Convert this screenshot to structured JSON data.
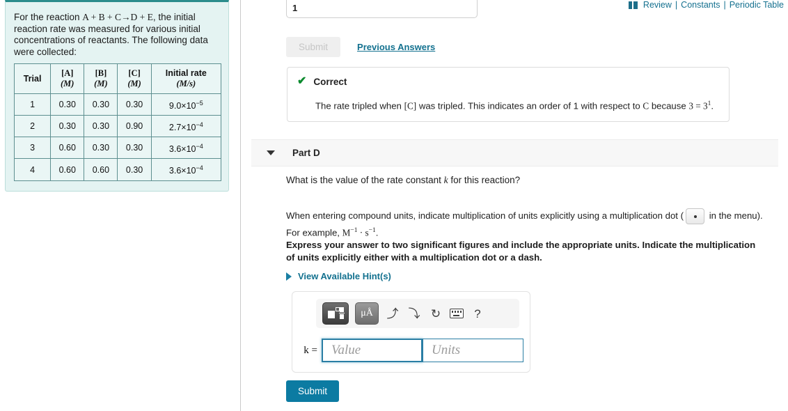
{
  "top_nav": {
    "icon": "review-book-icon",
    "items": [
      "Review",
      "Constants",
      "Periodic Table"
    ],
    "separator": "|",
    "link_color": "#14708f"
  },
  "problem_panel": {
    "intro_html": "For the reaction A + B + C→D + E, the initial reaction rate was measured for various initial concentrations of reactants. The following data were collected:",
    "intro_prefix": "For the reaction ",
    "reaction": "A + B + C→D + E",
    "intro_suffix": ", the initial reaction rate was measured for various initial concentrations of reactants. The following data were collected:",
    "table": {
      "headers": [
        {
          "top": "Trial",
          "bottom": ""
        },
        {
          "top": "[A]",
          "bottom": "(M)"
        },
        {
          "top": "[B]",
          "bottom": "(M)"
        },
        {
          "top": "[C]",
          "bottom": "(M)"
        },
        {
          "top": "Initial rate",
          "bottom": "(M/s)"
        }
      ],
      "rows": [
        {
          "trial": "1",
          "a": "0.30",
          "b": "0.30",
          "c": "0.30",
          "rate_mant": "9.0×10",
          "rate_exp": "−5"
        },
        {
          "trial": "2",
          "a": "0.30",
          "b": "0.30",
          "c": "0.90",
          "rate_mant": "2.7×10",
          "rate_exp": "−4"
        },
        {
          "trial": "3",
          "a": "0.60",
          "b": "0.30",
          "c": "0.30",
          "rate_mant": "3.6×10",
          "rate_exp": "−4"
        },
        {
          "trial": "4",
          "a": "0.60",
          "b": "0.60",
          "c": "0.30",
          "rate_mant": "3.6×10",
          "rate_exp": "−4"
        }
      ]
    },
    "bg_color": "#e4f3f2",
    "accent_color": "#2b8c8c"
  },
  "previous_part": {
    "answer_value": "1",
    "submit_label": "Submit",
    "previous_answers_label": "Previous Answers",
    "feedback": {
      "icon": "check-icon",
      "status": "Correct",
      "text_part1": "The rate tripled when ",
      "text_bracket_c": "[C]",
      "text_part2": " was tripled. This indicates an order of 1 with respect to ",
      "text_c": "C",
      "text_part3": " because ",
      "text_math": "3 = 3",
      "text_exp": "1",
      "text_end": ".",
      "status_color": "#0b8a2e"
    }
  },
  "part_d": {
    "title": "Part D",
    "caret": "caret-down-icon",
    "question_prefix": "What is the value of the rate constant ",
    "question_var": "k",
    "question_suffix": " for this reaction?",
    "units_note_1": "When entering compound units, indicate multiplication of units explicitly using a multiplication dot (",
    "units_note_2": " in the menu). For example, ",
    "units_example_m": "M",
    "units_example_m_exp": "−1",
    "units_example_dot": " · ",
    "units_example_s": "s",
    "units_example_s_exp": "−1",
    "units_note_end": ".",
    "express_note": "Express your answer to two significant figures and include the appropriate units. Indicate the multiplication of units explicitly either with a multiplication dot or a dash.",
    "hints_label": "View Available Hint(s)",
    "hints_caret": "caret-right-icon",
    "answer_widget": {
      "toolbar": [
        {
          "name": "math-template-button",
          "label": ""
        },
        {
          "name": "units-button",
          "label": "μÅ"
        },
        {
          "name": "undo-button",
          "label": "←"
        },
        {
          "name": "redo-button",
          "label": "→"
        },
        {
          "name": "reset-button",
          "label": "↺"
        },
        {
          "name": "keyboard-button",
          "label": ""
        },
        {
          "name": "help-button",
          "label": "?"
        }
      ],
      "k_label": "k =",
      "value_placeholder": "Value",
      "units_placeholder": "Units",
      "value_current": "",
      "units_current": "",
      "field_border_color": "#2a7ea4"
    },
    "submit_label": "Submit",
    "submit_color": "#0c7ba2"
  }
}
